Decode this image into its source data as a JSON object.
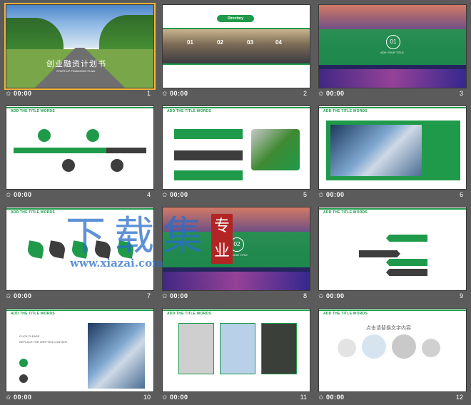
{
  "slides": [
    {
      "num": "1",
      "time": "00:00",
      "title": "创业融资计划书",
      "subtitle": "START-UP FINANCING PLAN"
    },
    {
      "num": "2",
      "time": "00:00",
      "title": "Directory",
      "items": [
        "01",
        "02",
        "03",
        "04"
      ]
    },
    {
      "num": "3",
      "time": "00:00",
      "badge": "01",
      "title": "ADD YOUR TITLE"
    },
    {
      "num": "4",
      "time": "00:00",
      "title": "ADD THE TITLE WORDS"
    },
    {
      "num": "5",
      "time": "00:00",
      "title": "ADD THE TITLE WORDS"
    },
    {
      "num": "6",
      "time": "00:00",
      "title": "ADD THE TITLE WORDS"
    },
    {
      "num": "7",
      "time": "00:00",
      "title": "ADD THE TITLE WORDS"
    },
    {
      "num": "8",
      "time": "00:00",
      "badge": "02",
      "title": "ADD YOUR TITLE"
    },
    {
      "num": "9",
      "time": "00:00",
      "title": "ADD THE TITLE WORDS"
    },
    {
      "num": "10",
      "time": "00:00",
      "title": "ADD THE TITLE WORDS",
      "line1": "CLICK PLEASE",
      "line2": "REPLACE THE WRITTEN CONTENT"
    },
    {
      "num": "11",
      "time": "00:00",
      "title": "ADD THE TITLE WORDS"
    },
    {
      "num": "12",
      "time": "00:00",
      "title": "ADD THE TITLE WORDS",
      "heading": "点击请替换文字内容"
    }
  ],
  "watermark": {
    "chars": "下载集",
    "url": "www.xiazai.com",
    "seal": "专业"
  },
  "colors": {
    "accent": "#1f9a4a",
    "selected": "#f3b43b",
    "background": "#5b5b5b"
  }
}
